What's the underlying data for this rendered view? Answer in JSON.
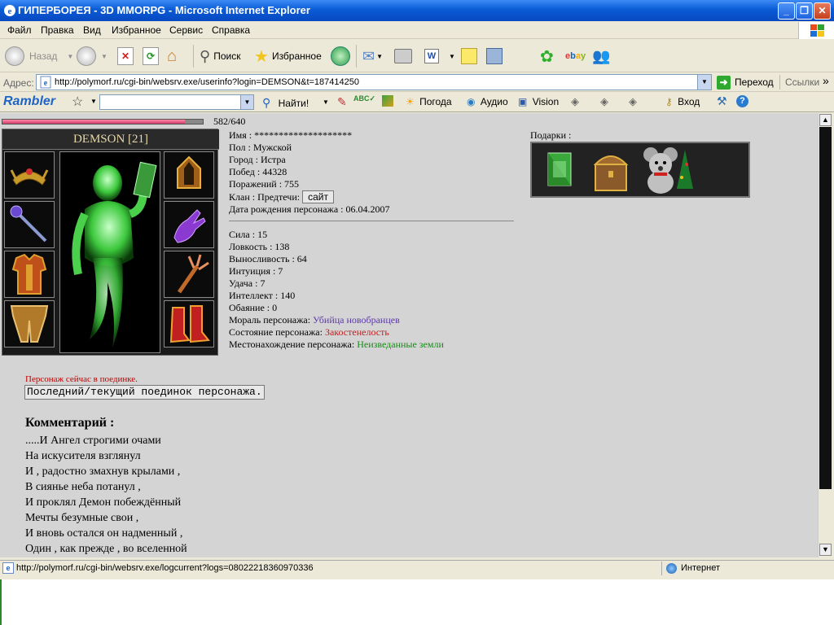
{
  "window": {
    "title": "ГИПЕРБОРЕЯ - 3D MMORPG - Microsoft Internet Explorer",
    "btn_min": "_",
    "btn_max": "❐",
    "btn_close": "✕"
  },
  "menu": [
    "Файл",
    "Правка",
    "Вид",
    "Избранное",
    "Сервис",
    "Справка"
  ],
  "toolbar": {
    "back": "Назад",
    "search": "Поиск",
    "favorites": "Избранное"
  },
  "address": {
    "label": "Адрес:",
    "url": "http://polymorf.ru/cgi-bin/websrv.exe/userinfo?login=DEMSON&t=187414250",
    "go": "Переход",
    "links": "Ссылки",
    "more": "»"
  },
  "rambler": {
    "logo": "Rambler",
    "find": "Найти!",
    "weather": "Погода",
    "audio": "Аудио",
    "vision": "Vision",
    "login": "Вход"
  },
  "character": {
    "hp_text": "582/640",
    "hp_current": 582,
    "hp_max": 640,
    "name": "DEMSON [21]",
    "info": {
      "name": "Имя : ********************",
      "gender": "Пол : Мужской",
      "city": "Город : Истра",
      "wins": "Побед : 44328",
      "losses": "Поражений : 755",
      "clan": "Клан : Предтечи:",
      "clan_site": "сайт",
      "birth": "Дата рождения персонажа : 06.04.2007"
    },
    "stats": {
      "str": "Сила : 15",
      "agi": "Ловкость : 138",
      "end": "Выносливость : 64",
      "int": "Интуиция : 7",
      "luck": "Удача : 7",
      "intel": "Интеллект : 140",
      "charm": "Обаяние : 0"
    },
    "morale_label": "Мораль персонажа:",
    "morale_value": "Убийца новобранцев",
    "state_label": "Состояние персонажа:",
    "state_value": "Закостенелость",
    "location_label": "Местонахождение персонажа:",
    "location_value": "Неизведанные земли",
    "gifts_label": "Подарки :",
    "fight_msg": "Персонаж сейчас в поединке.",
    "fight_button": "Последний/текущий поединок персонажа.",
    "comment_head": "Комментарий :",
    "comment_lines": [
      ".....И Ангел строгими очами",
      "На искусителя взглянул",
      "И , радостно змахнув крылами ,",
      "В сиянье неба потанул ,",
      "И проклял Демон побеждённый",
      "Мечты безумные свои ,",
      "И вновь остался он надменный ,",
      "Один , как прежде , во вселенной"
    ]
  },
  "status": {
    "url": "http://polymorf.ru/cgi-bin/websrv.exe/logcurrent?logs=08022218360970336",
    "zone": "Интернет"
  }
}
